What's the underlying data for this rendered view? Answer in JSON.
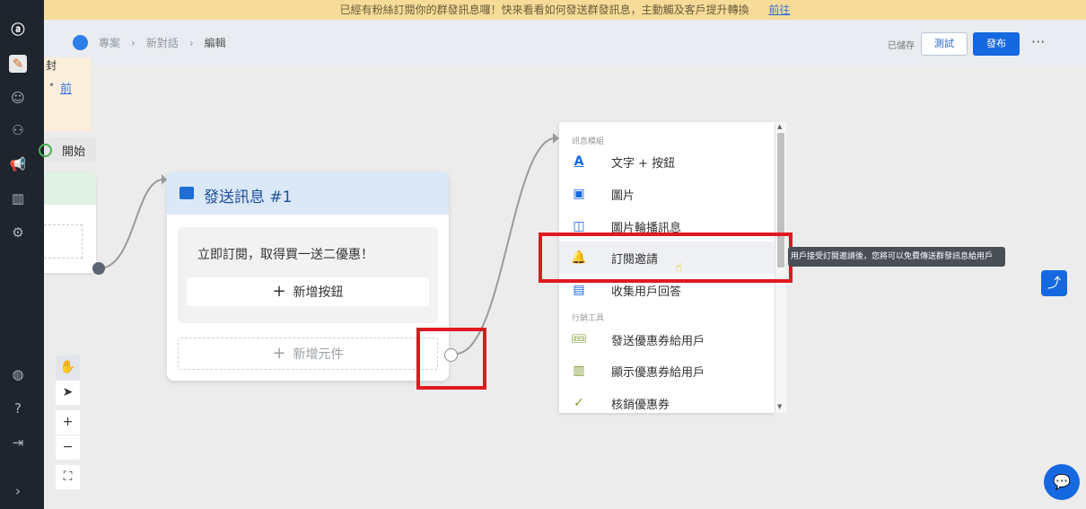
{
  "banner": {
    "text": "已經有粉絲訂閱你的群發訊息囉！快來看看如何發送群發訊息，主動觸及客戶提升轉換",
    "link": "前往"
  },
  "breadcrumb": {
    "project": "專案",
    "conversation": "新對話",
    "current": "編輯"
  },
  "header": {
    "saved": "已儲存",
    "test": "測試",
    "publish": "發布",
    "more": "···"
  },
  "canvas": {
    "note_line1": "封",
    "note_line2": "前",
    "start_label": "開始",
    "send_card": {
      "title": "發送訊息 #1",
      "message": "立即訂閱，取得買一送二優惠！",
      "add_button": "新增按鈕",
      "add_element": "新增元件"
    }
  },
  "menu": {
    "section1": "訊息模組",
    "section2": "行銷工具",
    "items": [
      {
        "label": "文字 + 按鈕",
        "icon": "text-icon"
      },
      {
        "label": "圖片",
        "icon": "image-icon"
      },
      {
        "label": "圖片輪播訊息",
        "icon": "carousel-icon"
      },
      {
        "label": "訂閱邀請",
        "icon": "bell-icon"
      },
      {
        "label": "收集用戶回答",
        "icon": "collect-icon"
      },
      {
        "label": "發送優惠券給用戶",
        "icon": "coupon-send-icon"
      },
      {
        "label": "顯示優惠券給用戶",
        "icon": "coupon-show-icon"
      },
      {
        "label": "核銷優惠券",
        "icon": "coupon-redeem-icon"
      }
    ]
  },
  "tooltip": "用戶接受訂閱邀請後，您將可以免費傳送群發訊息給用戶",
  "colors": {
    "accent": "#1668e0",
    "highlight": "#e0191f",
    "banner": "#f6dc98"
  }
}
